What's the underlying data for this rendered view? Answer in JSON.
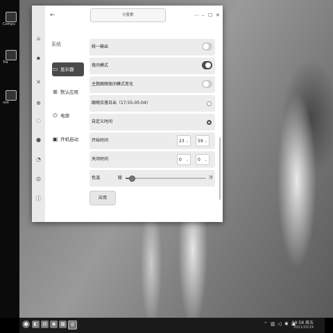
{
  "desktop": {
    "icons": [
      {
        "label": "Compu",
        "icon": "computer-icon"
      },
      {
        "label": "Tra",
        "icon": "trash-icon"
      },
      {
        "label": "use",
        "icon": "home-folder-icon"
      }
    ]
  },
  "window": {
    "search_placeholder": "搜索",
    "controls": [
      "⋯",
      "–",
      "☐",
      "✕"
    ],
    "section_title": "系统",
    "nav": [
      {
        "label": "显示器",
        "icon": "monitor-icon",
        "active": true
      },
      {
        "label": "默认应用",
        "icon": "apps-grid-icon",
        "active": false
      },
      {
        "label": "电源",
        "icon": "power-icon",
        "active": false
      },
      {
        "label": "开机启动",
        "icon": "startup-icon",
        "active": false
      }
    ],
    "settings": {
      "unified_output": {
        "label": "统一输出",
        "on": false
      },
      "night_mode": {
        "label": "夜间模式",
        "on": true
      },
      "follow_theme": {
        "label": "主题跟随夜间模式变化",
        "on": false
      },
      "sunset_sunrise": {
        "label": "跟随日落日出（17:55-05:04)",
        "selected": false
      },
      "custom_time": {
        "label": "自定义时间",
        "selected": true
      },
      "start_time": {
        "label": "开始时间",
        "hour": "23",
        "minute": "59"
      },
      "end_time": {
        "label": "关闭时间",
        "hour": "0",
        "minute": "0"
      },
      "color_temp": {
        "label": "色温",
        "low": "暖",
        "high": "冷",
        "value": 0.08
      }
    },
    "apply_label": "应用"
  },
  "taskbar": {
    "time": "19:58 周五",
    "date": "2021/03/19"
  },
  "colors": {
    "accent": "#4a4a4a",
    "row_bg": "#ececec"
  }
}
